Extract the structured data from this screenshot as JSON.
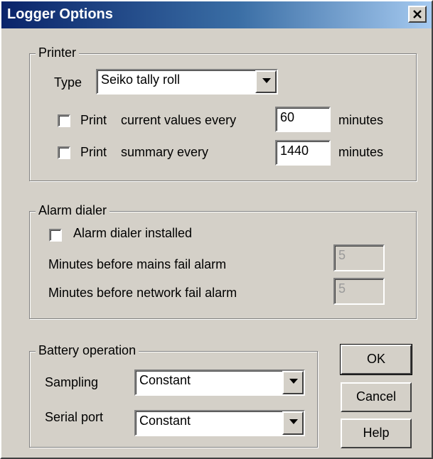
{
  "window": {
    "title": "Logger Options"
  },
  "printer": {
    "group_label": "Printer",
    "type_label": "Type",
    "type_value": "Seiko tally roll",
    "print_label": "Print",
    "current_values_label": "current values every",
    "current_values_checked": false,
    "current_values_minutes": "60",
    "summary_label": "summary every",
    "summary_checked": false,
    "summary_minutes": "1440",
    "minutes_label": "minutes"
  },
  "alarm_dialer": {
    "group_label": "Alarm dialer",
    "installed_label": "Alarm dialer installed",
    "installed_checked": false,
    "mains_fail_label": "Minutes before mains fail alarm",
    "mains_fail_value": "5",
    "network_fail_label": "Minutes before network fail alarm",
    "network_fail_value": "5"
  },
  "battery": {
    "group_label": "Battery operation",
    "sampling_label": "Sampling",
    "sampling_value": "Constant",
    "serial_port_label": "Serial port",
    "serial_port_value": "Constant"
  },
  "buttons": {
    "ok": "OK",
    "cancel": "Cancel",
    "help": "Help"
  }
}
